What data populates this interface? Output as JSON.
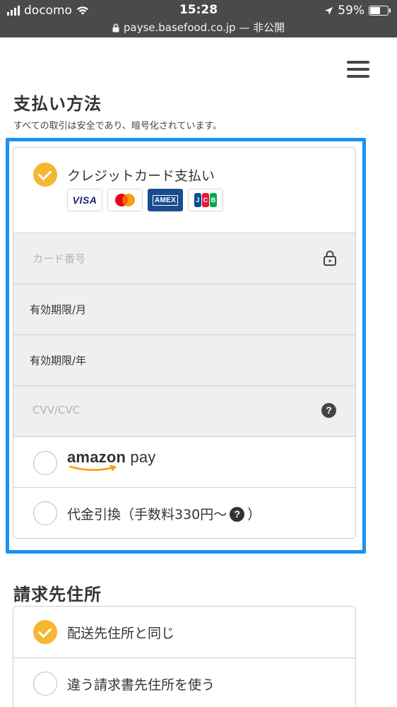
{
  "status_bar": {
    "carrier": "docomo",
    "time": "15:28",
    "battery": "59%",
    "battery_level": 0.59,
    "url": "payse.basefood.co.jp",
    "url_suffix": " — 非公開"
  },
  "payment": {
    "title": "支払い方法",
    "subtitle": "すべての取引は安全であり、暗号化されています。",
    "credit_card_label": "クレジットカード支払い",
    "card_brands": {
      "visa": "VISA",
      "amex": "AMEX",
      "jcb": [
        "J",
        "C",
        "B"
      ]
    },
    "card_number_placeholder": "カード番号",
    "expiry_month_label": "有効期限/月",
    "expiry_year_label": "有効期限/年",
    "cvv_placeholder": "CVV/CVC",
    "amazon_pay": {
      "amazon": "amazon",
      "pay": " pay"
    },
    "cod_label_prefix": "代金引換（手数料330円〜",
    "cod_help": "?",
    "cod_label_suffix": "）",
    "help_symbol": "?"
  },
  "billing": {
    "title": "請求先住所",
    "same_address_label": "配送先住所と同じ",
    "different_address_label": "違う請求書先住所を使う"
  },
  "colors": {
    "accent": "#f5b731",
    "highlight": "#1e90ee",
    "statusbar": "#4a4a4a"
  }
}
